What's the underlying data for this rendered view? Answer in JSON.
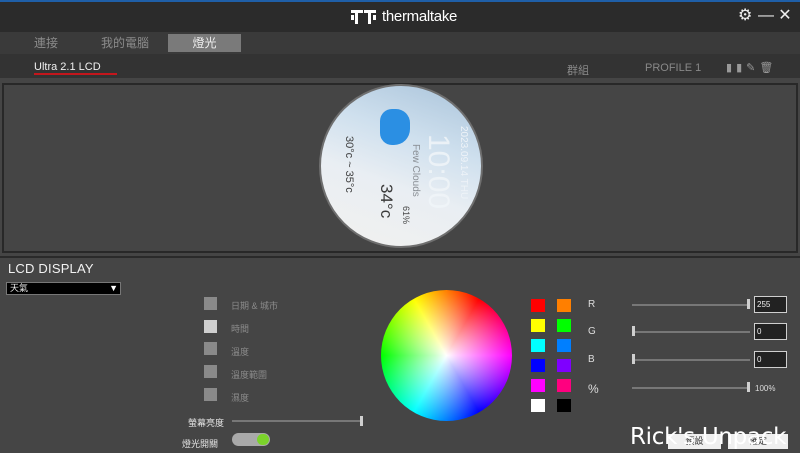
{
  "app": {
    "brand": "thermaltake"
  },
  "window_controls": {
    "settings_icon": "gear-icon",
    "minimize_icon": "minimize-icon",
    "close_icon": "close-icon"
  },
  "tabs": [
    {
      "label": "連接"
    },
    {
      "label": "我的電腦"
    },
    {
      "label": "燈光"
    }
  ],
  "device": {
    "tab_label": "Ultra 2.1 LCD"
  },
  "profile": {
    "group_label": "群組",
    "profile_label": "PROFILE 1"
  },
  "lcd_preview": {
    "date": "2023.09.14 THU",
    "time": "10:00",
    "condition": "Few Clouds",
    "temp_range": "30°c ~ 35°c",
    "temperature": "34°c",
    "humidity": "61%"
  },
  "lcd_display": {
    "title": "LCD DISPLAY",
    "mode_value": "天氣",
    "options": [
      {
        "label": "日期 & 城市"
      },
      {
        "label": "時間"
      },
      {
        "label": "溫度"
      },
      {
        "label": "溫度範圍"
      },
      {
        "label": "濕度"
      }
    ],
    "brightness_label": "螢幕亮度",
    "brightness": 1.0,
    "light_switch_label": "燈光開關",
    "light_switch_on": true
  },
  "color": {
    "swatches": [
      "#ff0000",
      "#ff7f00",
      "#ffff00",
      "#00ff00",
      "#00ffff",
      "#007fff",
      "#0000ff",
      "#7f00ff",
      "#ff00ff",
      "#ff007f",
      "#ffffff",
      "#000000"
    ],
    "r_label": "R",
    "r_value": "255",
    "g_label": "G",
    "g_value": "0",
    "b_label": "B",
    "b_value": "0",
    "pct_label": "%",
    "pct_value": "100%"
  },
  "buttons": {
    "apply": "預設",
    "ok": "確定"
  },
  "watermark": "Rick's Unpack"
}
